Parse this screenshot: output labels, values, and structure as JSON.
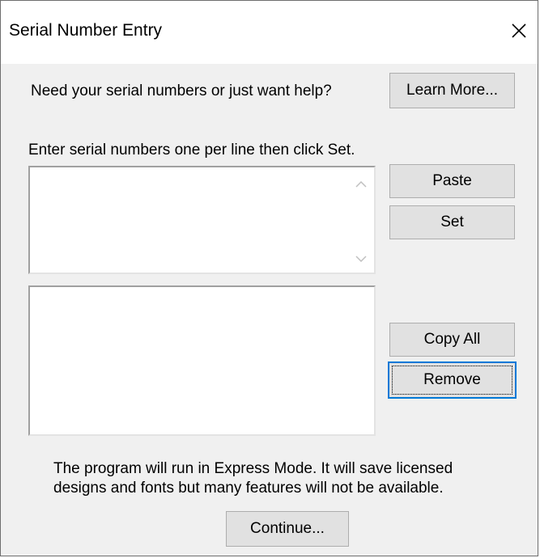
{
  "window": {
    "title": "Serial Number Entry",
    "close_icon": "close-icon"
  },
  "help": {
    "prompt": "Need your serial numbers or just want help?",
    "learn_more_label": "Learn More..."
  },
  "entry": {
    "instruction": "Enter serial numbers one per line then click Set.",
    "serials_value": "",
    "paste_label": "Paste",
    "set_label": "Set",
    "scroll_up_icon": "chevron-up-icon",
    "scroll_down_icon": "chevron-down-icon"
  },
  "list": {
    "items": [],
    "copy_all_label": "Copy All",
    "remove_label": "Remove"
  },
  "footer": {
    "message_line1": "The program will run in Express Mode. It will save licensed",
    "message_line2": "designs and fonts but many features will not be available.",
    "continue_label": "Continue..."
  }
}
